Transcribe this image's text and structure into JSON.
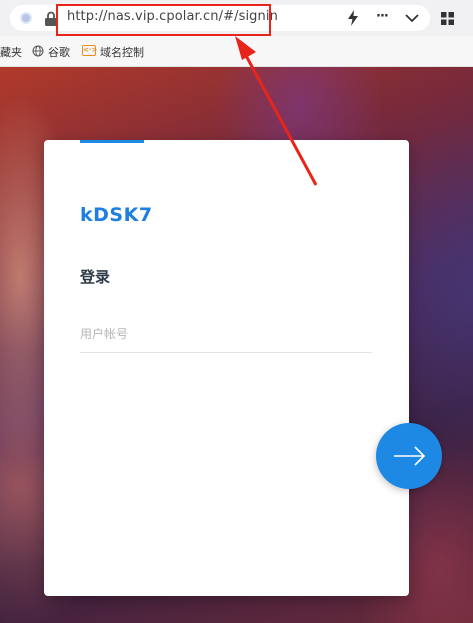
{
  "browser": {
    "url": "http://nas.vip.cpolar.cn/#/signin",
    "more_glyph": "···"
  },
  "bookmarks": {
    "items": [
      {
        "label": "藏夹"
      },
      {
        "label": "谷歌"
      },
      {
        "label": "域名控制"
      }
    ],
    "domain_icon_glyph": "<·>"
  },
  "login": {
    "app_name": "kDSK7",
    "heading": "登录",
    "username_placeholder": "用户帐号",
    "username_value": ""
  },
  "colors": {
    "accent": "#1e88e5",
    "annotation": "#e8241b"
  }
}
